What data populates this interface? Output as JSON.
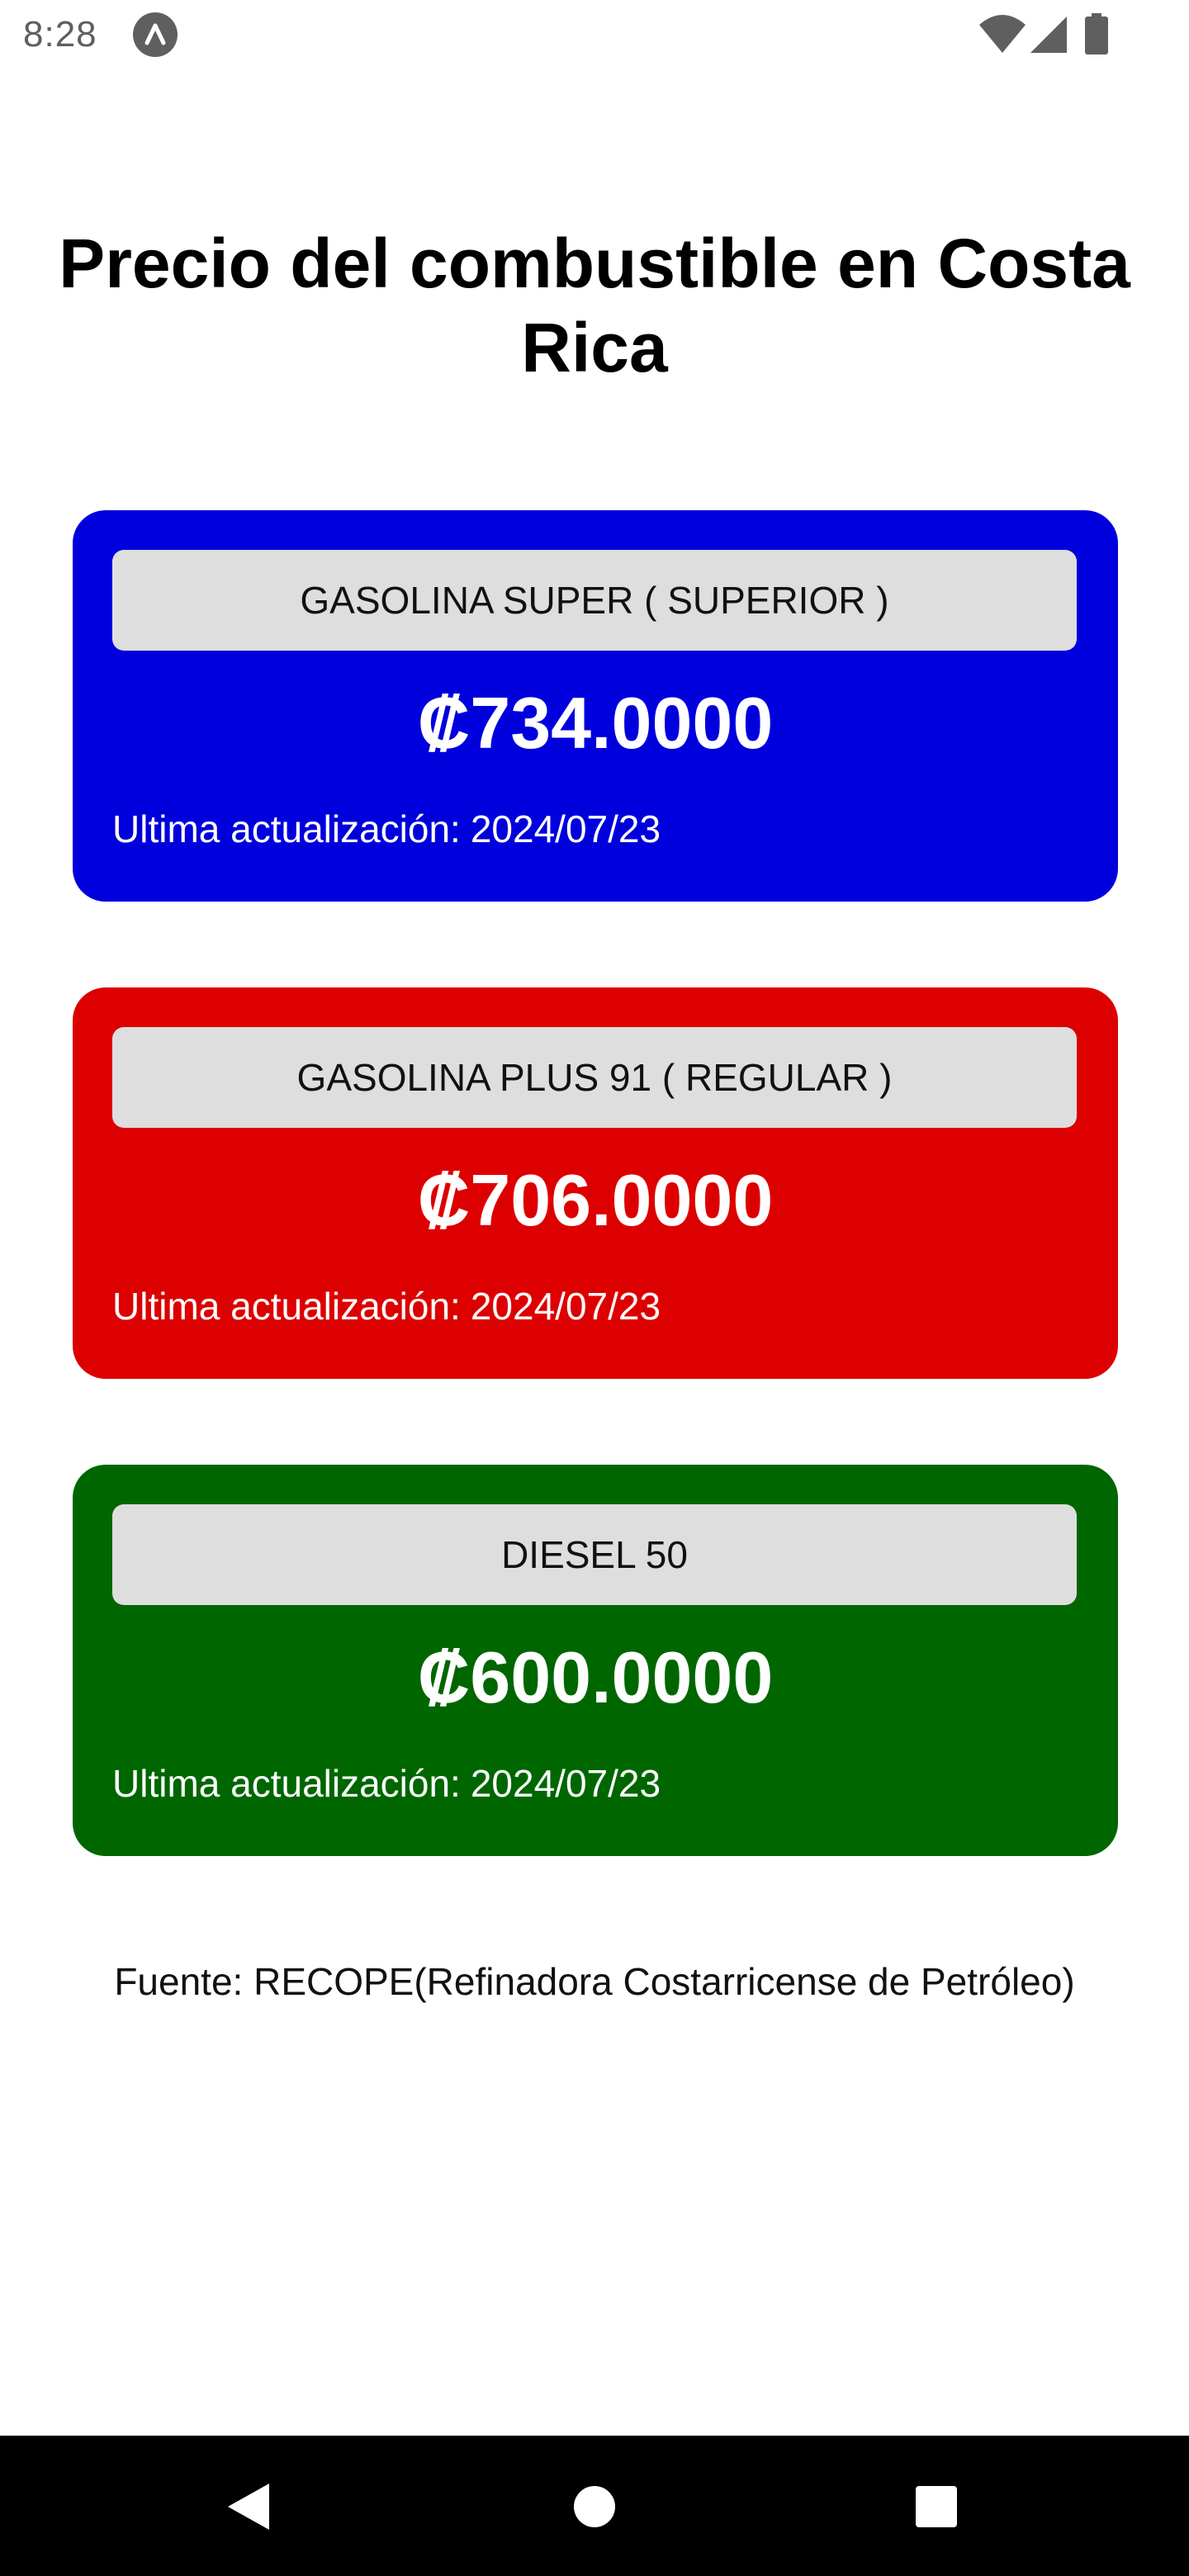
{
  "status_bar": {
    "time": "8:28",
    "icons": [
      "app-notification-icon",
      "wifi-icon",
      "cell-signal-icon",
      "battery-icon"
    ]
  },
  "page": {
    "title": "Precio del combustible en Costa Rica"
  },
  "fuels": [
    {
      "name": "GASOLINA SUPER ( SUPERIOR )",
      "price": "₡734.0000",
      "updated_label": "Ultima actualización:",
      "updated_date": "2024/07/23",
      "color": "#0000dd"
    },
    {
      "name": "GASOLINA PLUS 91 ( REGULAR )",
      "price": "₡706.0000",
      "updated_label": "Ultima actualización:",
      "updated_date": "2024/07/23",
      "color": "#dd0000"
    },
    {
      "name": "DIESEL 50",
      "price": "₡600.0000",
      "updated_label": "Ultima actualización:",
      "updated_date": "2024/07/23",
      "color": "#006600"
    }
  ],
  "source": "Fuente: RECOPE(Refinadora Costarricense de Petróleo)",
  "nav_bar": {
    "icons": [
      "back-icon",
      "home-icon",
      "recents-icon"
    ]
  }
}
